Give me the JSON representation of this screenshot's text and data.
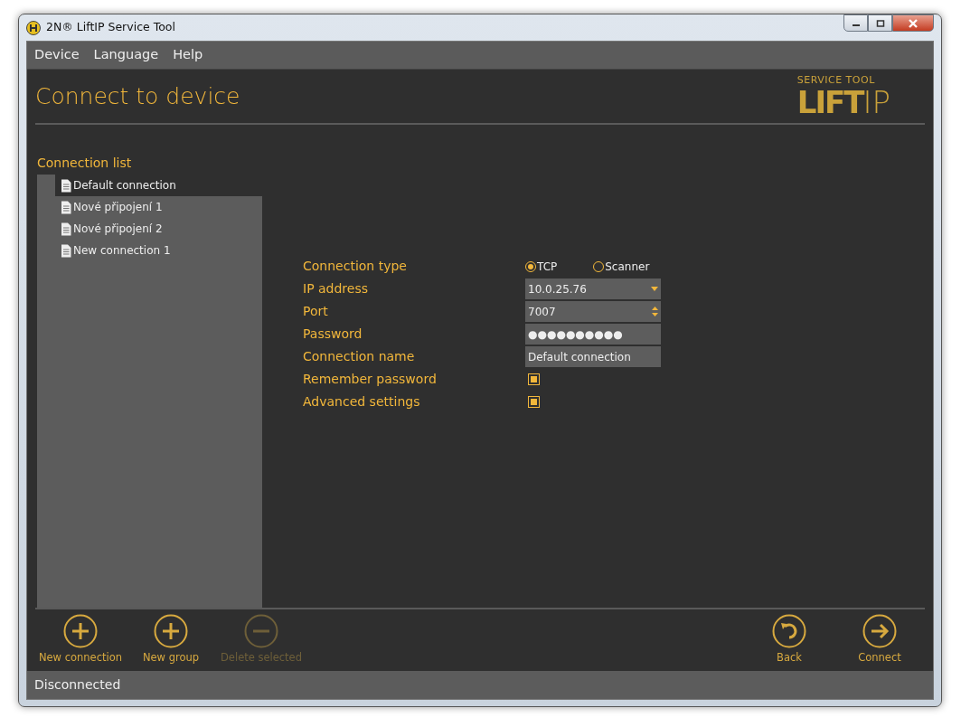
{
  "window": {
    "title": "2N® LiftIP Service Tool"
  },
  "menu": [
    "Device",
    "Language",
    "Help"
  ],
  "page_title": "Connect to device",
  "logo": {
    "caption": "SERVICE TOOL",
    "word_bold": "LIFT",
    "word_thin": "IP"
  },
  "connection_list": {
    "label": "Connection list",
    "items": [
      {
        "label": "Default connection",
        "selected": true
      },
      {
        "label": "Nové připojení 1",
        "selected": false
      },
      {
        "label": "Nové připojení 2",
        "selected": false
      },
      {
        "label": "New connection 1",
        "selected": false
      }
    ]
  },
  "form": [
    {
      "kind": "radio",
      "label": "Connection type",
      "options": [
        {
          "label": "TCP",
          "selected": true
        },
        {
          "label": "Scanner",
          "selected": false
        }
      ]
    },
    {
      "kind": "combo",
      "label": "IP address",
      "value": "10.0.25.76"
    },
    {
      "kind": "spin",
      "label": "Port",
      "value": "7007"
    },
    {
      "kind": "password",
      "label": "Password",
      "value": "●●●●●●●●●●"
    },
    {
      "kind": "text",
      "label": "Connection name",
      "value": "Default connection"
    },
    {
      "kind": "checkbox",
      "label": "Remember password",
      "checked": true
    },
    {
      "kind": "checkbox",
      "label": "Advanced settings",
      "checked": true
    }
  ],
  "left_buttons": [
    {
      "kind": "plus",
      "label": "New connection",
      "disabled": false
    },
    {
      "kind": "plus",
      "label": "New group",
      "disabled": false
    },
    {
      "kind": "minus",
      "label": "Delete selected",
      "disabled": true
    }
  ],
  "right_buttons": [
    {
      "kind": "back",
      "label": "Back",
      "disabled": false
    },
    {
      "kind": "arrow",
      "label": "Connect",
      "disabled": false
    }
  ],
  "status_bar": "Disconnected"
}
